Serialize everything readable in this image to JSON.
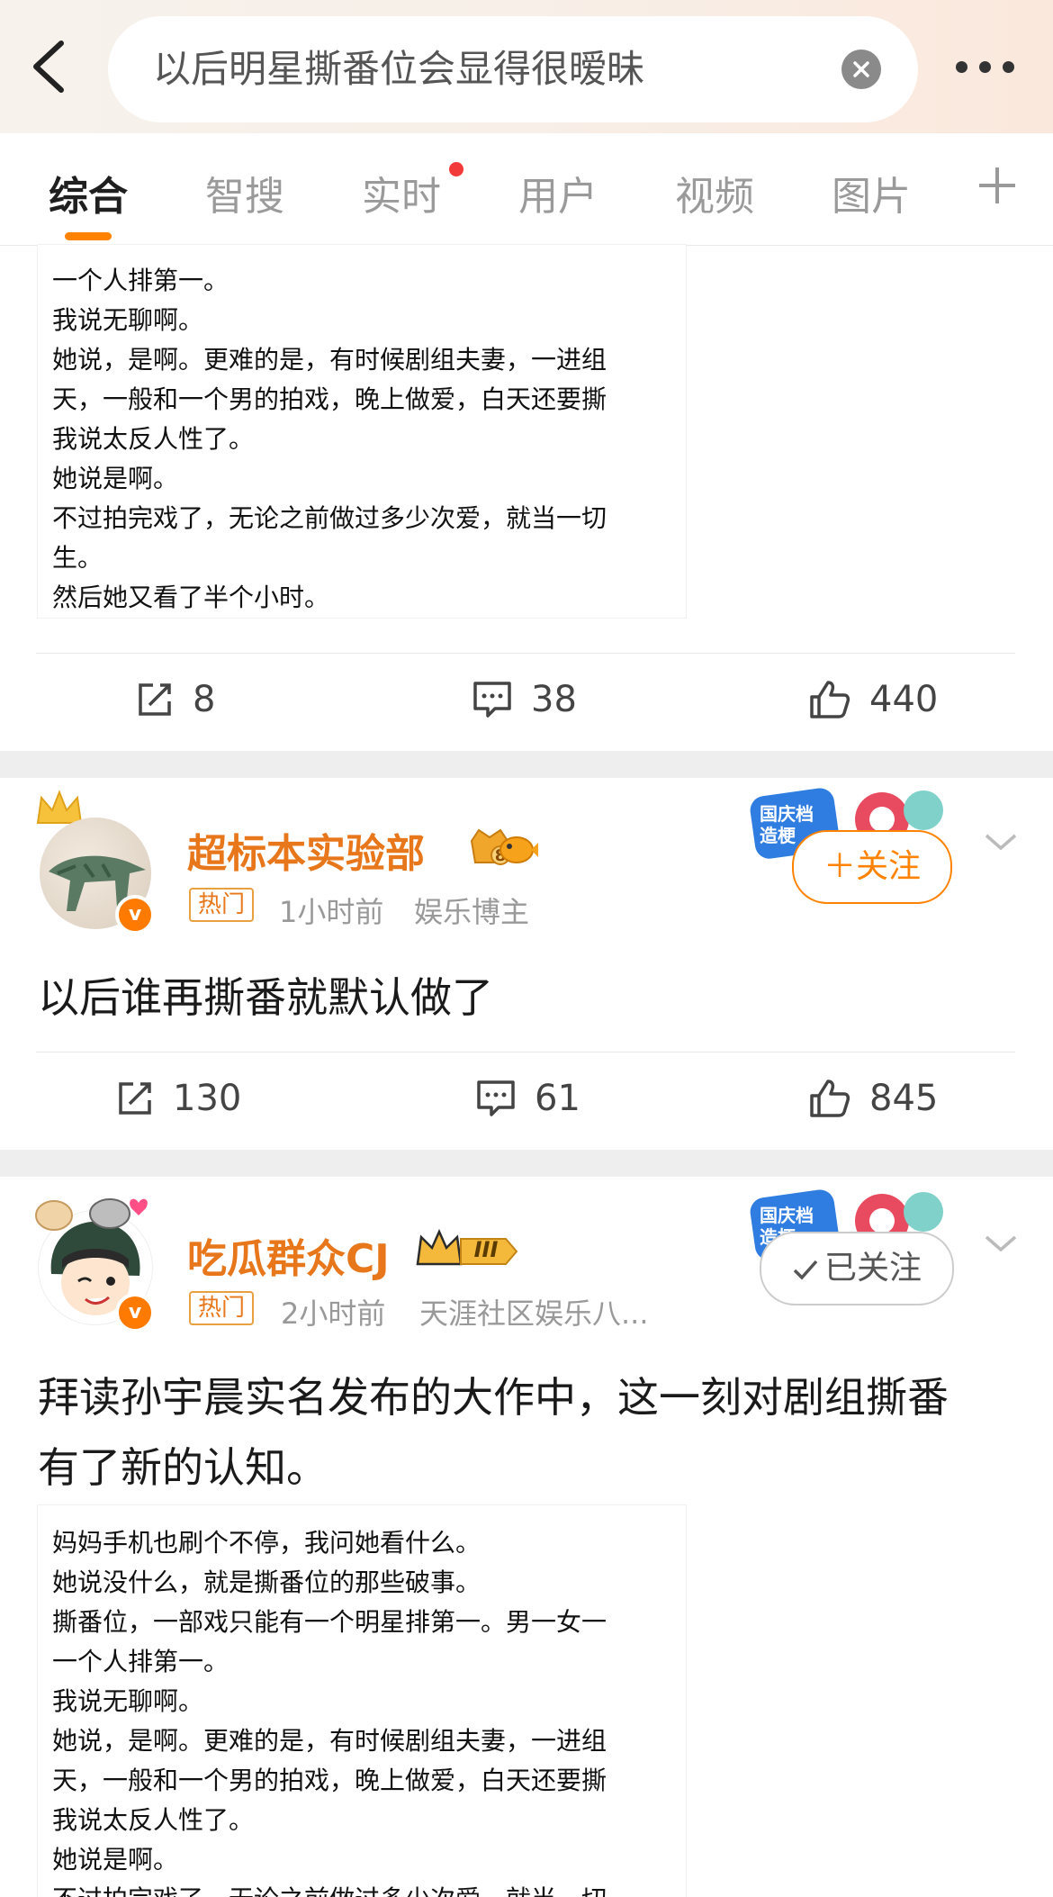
{
  "search": {
    "query": "以后明星撕番位会显得很暧昧"
  },
  "tabs": [
    {
      "label": "综合"
    },
    {
      "label": "智搜"
    },
    {
      "label": "实时"
    },
    {
      "label": "用户"
    },
    {
      "label": "视频"
    },
    {
      "label": "图片"
    }
  ],
  "first_post": {
    "article_lines": [
      "一个人排第一。",
      "我说无聊啊。",
      "她说，是啊。更难的是，有时候剧组夫妻，一进组",
      "天，一般和一个男的拍戏，晚上做爱，白天还要撕",
      "我说太反人性了。",
      "她说是啊。",
      "不过拍完戏了，无论之前做过多少次爱，就当一切",
      "生。",
      "然后她又看了半个小时。"
    ],
    "reposts": "8",
    "comments": "38",
    "likes": "440"
  },
  "second_post": {
    "username": "超标本实验部",
    "hot_label": "热门",
    "time": "1小时前",
    "source": "娱乐博主",
    "follow_label": "＋关注",
    "deco_text": "国庆档 造梗",
    "text": "以后谁再撕番就默认做了",
    "reposts": "130",
    "comments": "61",
    "likes": "845",
    "vip_level": "8"
  },
  "third_post": {
    "username": "吃瓜群众CJ",
    "hot_label": "热门",
    "time": "2小时前",
    "source": "天涯社区娱乐八...",
    "follow_label": "已关注",
    "deco_text": "国庆档 造梗",
    "badge_level": "III",
    "text_line1": "拜读孙宇晨实名发布的大作中，这一刻对剧组撕番",
    "text_line2": "有了新的认知。",
    "article_lines": [
      "妈妈手机也刷个不停，我问她看什么。",
      "她说没什么，就是撕番位的那些破事。",
      "撕番位，一部戏只能有一个明星排第一。男一女一",
      "一个人排第一。",
      "我说无聊啊。",
      "她说，是啊。更难的是，有时候剧组夫妻，一进组",
      "天，一般和一个男的拍戏，晚上做爱，白天还要撕",
      "我说太反人性了。",
      "她说是啊。",
      "不过拍完戏了，无论之前做过多少次爱，就当一切"
    ]
  },
  "colors": {
    "accent": "#ff8200",
    "username": "#e8761a",
    "red_dot": "#f23a3a"
  }
}
